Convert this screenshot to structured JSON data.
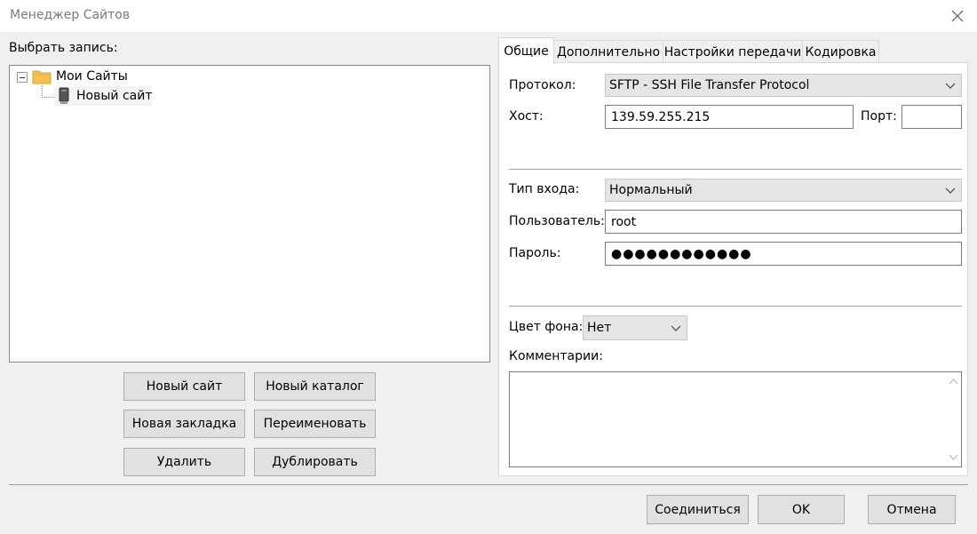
{
  "window": {
    "title": "Менеджер Сайтов"
  },
  "left": {
    "select_label": "Выбрать запись:",
    "tree": {
      "root": {
        "label": "Мои Сайты",
        "expander": "⊟",
        "icon": "folder-icon"
      },
      "child": {
        "label": "Новый сайт",
        "icon": "server-icon"
      }
    },
    "buttons": {
      "new_site": "Новый сайт",
      "new_folder": "Новый каталог",
      "new_bookmark": "Новая закладка",
      "rename": "Переименовать",
      "delete": "Удалить",
      "duplicate": "Дублировать"
    }
  },
  "tabs": [
    {
      "label": "Общие",
      "active": true
    },
    {
      "label": "Дополнительно",
      "active": false
    },
    {
      "label": "Настройки передачи",
      "active": false
    },
    {
      "label": "Кодировка",
      "active": false
    }
  ],
  "general": {
    "protocol_label": "Протокол:",
    "protocol_value": "SFTP - SSH File Transfer Protocol",
    "host_label": "Хост:",
    "host_value": "139.59.255.215",
    "port_label": "Порт:",
    "port_value": "",
    "logon_label": "Тип входа:",
    "logon_value": "Нормальный",
    "user_label": "Пользователь:",
    "user_value": "root",
    "password_label": "Пароль:",
    "password_value": "●●●●●●●●●●●●",
    "bgcolor_label": "Цвет фона:",
    "bgcolor_value": "Нет",
    "comments_label": "Комментарии:",
    "comments_value": ""
  },
  "footer": {
    "connect": "Соединиться",
    "ok": "OK",
    "cancel": "Отмена"
  },
  "colors": {
    "client_bg": "#f0f0f0",
    "button_bg": "#e1e1e1",
    "folder": "#f2c14e",
    "selection_bg": "#f3f3f3"
  }
}
